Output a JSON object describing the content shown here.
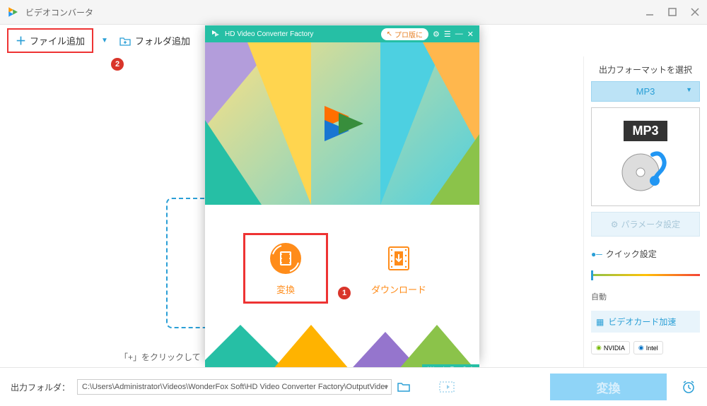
{
  "app": {
    "title": "ビデオコンバータ"
  },
  "toolbar": {
    "add_file": "ファイル追加",
    "add_folder": "フォルダ追加"
  },
  "badges": {
    "b1": "1",
    "b2": "2"
  },
  "main": {
    "drop_hint": "「+」をクリックして"
  },
  "splash": {
    "title": "HD Video Converter Factory",
    "pro_btn": "プロ版に",
    "convert": "変換",
    "download": "ダウンロード",
    "brand": "WonderFox Soft"
  },
  "sidebar": {
    "output_title": "出力フォーマットを選択",
    "format": "MP3",
    "format_badge": "MP3",
    "param_btn": "パラメータ設定",
    "quick_title": "クイック設定",
    "auto": "自動",
    "gpu_accel": "ビデオカード加速",
    "nvidia": "NVIDIA",
    "intel": "Intel"
  },
  "bottom": {
    "label": "出力フォルダ：",
    "path": "C:\\Users\\Administrator\\Videos\\WonderFox Soft\\HD Video Converter Factory\\OutputVideo\\",
    "convert": "変換"
  }
}
